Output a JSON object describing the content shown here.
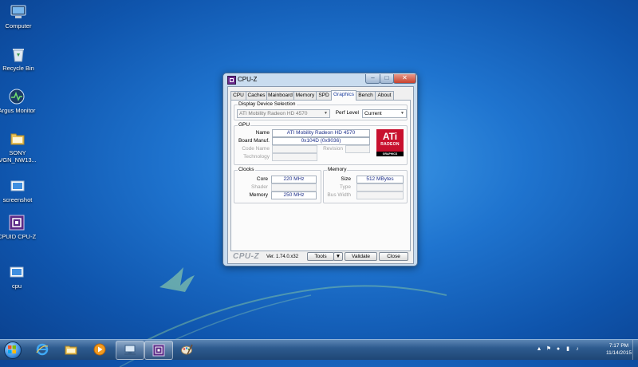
{
  "desktop": {
    "icons": [
      {
        "label": "Computer"
      },
      {
        "label": "Recycle Bin"
      },
      {
        "label": "Argus Monitor"
      },
      {
        "label": "SONY VGN_NW13..."
      },
      {
        "label": "screenshot"
      },
      {
        "label": "CPUID CPU-Z"
      },
      {
        "label": "cpu"
      }
    ]
  },
  "window": {
    "title": "CPU-Z",
    "controls": {
      "minimize": "–",
      "maximize": "□",
      "close": "✕"
    },
    "tabs": [
      {
        "label": "CPU"
      },
      {
        "label": "Caches"
      },
      {
        "label": "Mainboard"
      },
      {
        "label": "Memory"
      },
      {
        "label": "SPD"
      },
      {
        "label": "Graphics",
        "active": true
      },
      {
        "label": "Bench"
      },
      {
        "label": "About"
      }
    ],
    "display_selection": {
      "title": "Display Device Selection",
      "device": "ATI Mobility Radeon HD 4570",
      "perf_level_label": "Perf Level",
      "perf_level_value": "Current"
    },
    "gpu": {
      "title": "GPU",
      "name_label": "Name",
      "name_value": "ATI Mobility Radeon HD 4570",
      "board_label": "Board Manuf.",
      "board_value": "0x104D (0x9036)",
      "code_name_label": "Code Name",
      "revision_label": "Revision",
      "technology_label": "Technology",
      "logo": {
        "line1": "ATi",
        "line2": "RADEON",
        "line3": "GRAPHICS"
      }
    },
    "clocks": {
      "title": "Clocks",
      "core_label": "Core",
      "core_value": "220 MHz",
      "shader_label": "Shader",
      "memory_label": "Memory",
      "memory_value": "250 MHz"
    },
    "memory": {
      "title": "Memory",
      "size_label": "Size",
      "size_value": "512 MBytes",
      "type_label": "Type",
      "bus_width_label": "Bus Width"
    },
    "footer": {
      "brand": "CPU-Z",
      "version": "Ver. 1.74.0.x32",
      "tools_label": "Tools",
      "validate_label": "Validate",
      "close_label": "Close"
    }
  },
  "taskbar": {
    "pinned": [
      "internet-explorer",
      "file-explorer",
      "media-player",
      "network-app",
      "cpu-z",
      "paint"
    ],
    "clock_time": "7:17 PM",
    "clock_date": "11/14/2015"
  },
  "colors": {
    "accent_blue": "#1d3fa0",
    "ati_red": "#c8102e",
    "desktop_blue": "#1f74cf"
  }
}
